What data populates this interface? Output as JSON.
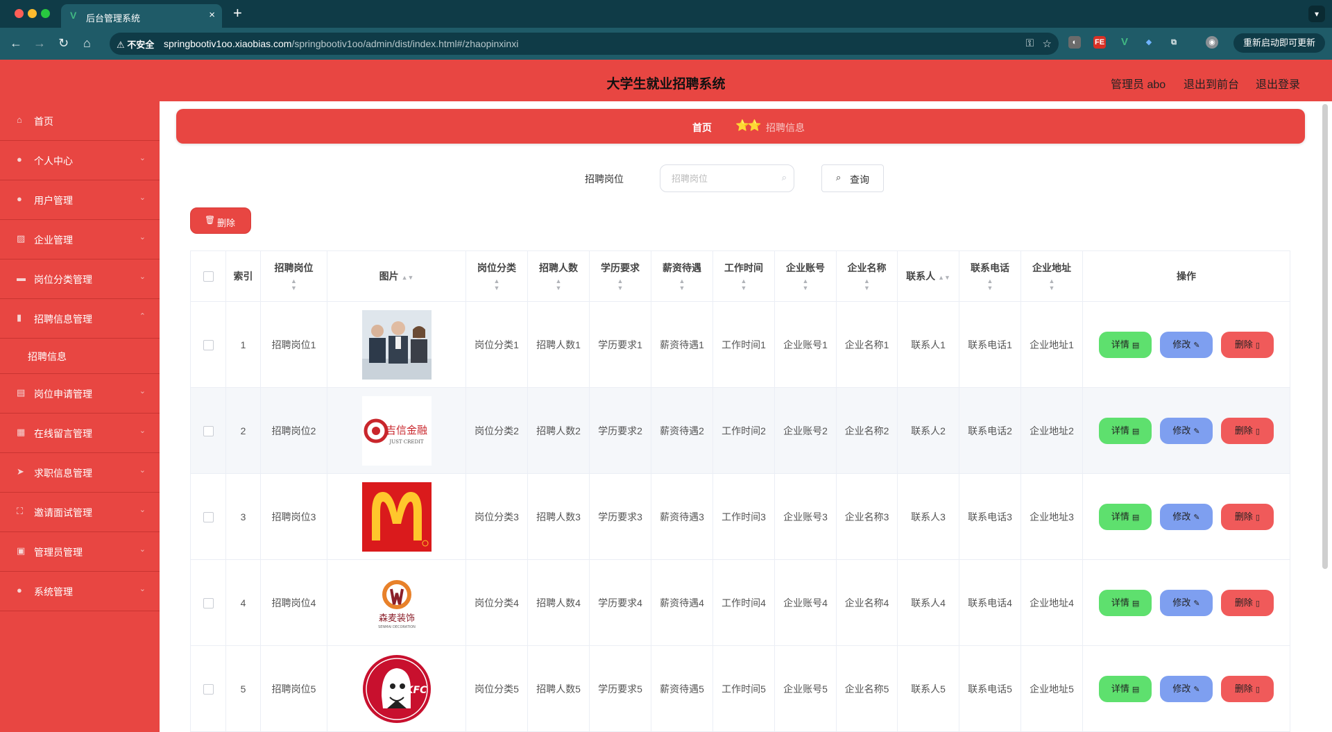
{
  "browser": {
    "tab_title": "后台管理系统",
    "insecure_label": "不安全",
    "url_host": "springbootiv1oo.xiaobias.com",
    "url_path": "/springbootiv1oo/admin/dist/index.html#/zhaopinxinxi",
    "update_label": "重新启动即可更新",
    "extension_fe_label": "FE",
    "extension_v_label": "V"
  },
  "header": {
    "title": "大学生就业招聘系统",
    "user_label": "管理员 abo",
    "front_link": "退出到前台",
    "logout_link": "退出登录"
  },
  "sidebar": {
    "items": [
      {
        "label": "首页",
        "icon": "home-icon",
        "expandable": false
      },
      {
        "label": "个人中心",
        "icon": "user-icon",
        "expandable": true
      },
      {
        "label": "用户管理",
        "icon": "user-icon",
        "expandable": true
      },
      {
        "label": "企业管理",
        "icon": "picture-icon",
        "expandable": true
      },
      {
        "label": "岗位分类管理",
        "icon": "monitor-icon",
        "expandable": true
      },
      {
        "label": "招聘信息管理",
        "icon": "bar-chart-icon",
        "expandable": true,
        "expanded": true
      },
      {
        "label": "岗位申请管理",
        "icon": "briefcase-icon",
        "expandable": true
      },
      {
        "label": "在线留言管理",
        "icon": "grid-icon",
        "expandable": true
      },
      {
        "label": "求职信息管理",
        "icon": "send-icon",
        "expandable": true
      },
      {
        "label": "邀请面试管理",
        "icon": "fullscreen-icon",
        "expandable": true
      },
      {
        "label": "管理员管理",
        "icon": "calculator-icon",
        "expandable": true
      },
      {
        "label": "系统管理",
        "icon": "location-icon",
        "expandable": true
      }
    ],
    "submenu_label": "招聘信息"
  },
  "breadcrumb": {
    "home": "首页",
    "separator": "⭐⭐",
    "current": "招聘信息"
  },
  "search": {
    "label": "招聘岗位",
    "placeholder": "招聘岗位",
    "value": "",
    "query_button": "查询"
  },
  "toolbar": {
    "delete_button": "删除"
  },
  "table": {
    "columns": [
      "索引",
      "招聘岗位",
      "图片",
      "岗位分类",
      "招聘人数",
      "学历要求",
      "薪资待遇",
      "工作时间",
      "企业账号",
      "企业名称",
      "联系人",
      "联系电话",
      "企业地址",
      "操作"
    ],
    "rows": [
      {
        "index": "1",
        "cells": [
          "招聘岗位1",
          "岗位分类1",
          "招聘人数1",
          "学历要求1",
          "薪资待遇1",
          "工作时间1",
          "企业账号1",
          "企业名称1",
          "联系人1",
          "联系电话1",
          "企业地址1"
        ],
        "image": "business-meeting-photo"
      },
      {
        "index": "2",
        "cells": [
          "招聘岗位2",
          "岗位分类2",
          "招聘人数2",
          "学历要求2",
          "薪资待遇2",
          "工作时间2",
          "企业账号2",
          "企业名称2",
          "联系人2",
          "联系电话2",
          "企业地址2"
        ],
        "image": "just-credit-logo",
        "logo_text": "吉信金融",
        "logo_sub": "JUST CREDIT"
      },
      {
        "index": "3",
        "cells": [
          "招聘岗位3",
          "岗位分类3",
          "招聘人数3",
          "学历要求3",
          "薪资待遇3",
          "工作时间3",
          "企业账号3",
          "企业名称3",
          "联系人3",
          "联系电话3",
          "企业地址3"
        ],
        "image": "mcdonalds-logo"
      },
      {
        "index": "4",
        "cells": [
          "招聘岗位4",
          "岗位分类4",
          "招聘人数4",
          "学历要求4",
          "薪资待遇4",
          "工作时间4",
          "企业账号4",
          "企业名称4",
          "联系人4",
          "联系电话4",
          "企业地址4"
        ],
        "image": "senmai-decoration-logo",
        "logo_text": "森麦装饰",
        "logo_sub": "SENMAI DECORATION"
      },
      {
        "index": "5",
        "cells": [
          "招聘岗位5",
          "岗位分类5",
          "招聘人数5",
          "学历要求5",
          "薪资待遇5",
          "工作时间5",
          "企业账号5",
          "企业名称5",
          "联系人5",
          "联系电话5",
          "企业地址5"
        ],
        "image": "kfc-logo",
        "logo_text": "KFC"
      }
    ],
    "actions": {
      "detail": "详情",
      "edit": "修改",
      "delete": "删除"
    }
  },
  "colors": {
    "primary_red": "#e84642",
    "chrome_dark": "#0f3b47",
    "chrome_toolbar": "#1f5b68",
    "detail_green": "#5ee06e",
    "edit_blue": "#7e9ff0",
    "delete_red": "#f05a5a"
  }
}
